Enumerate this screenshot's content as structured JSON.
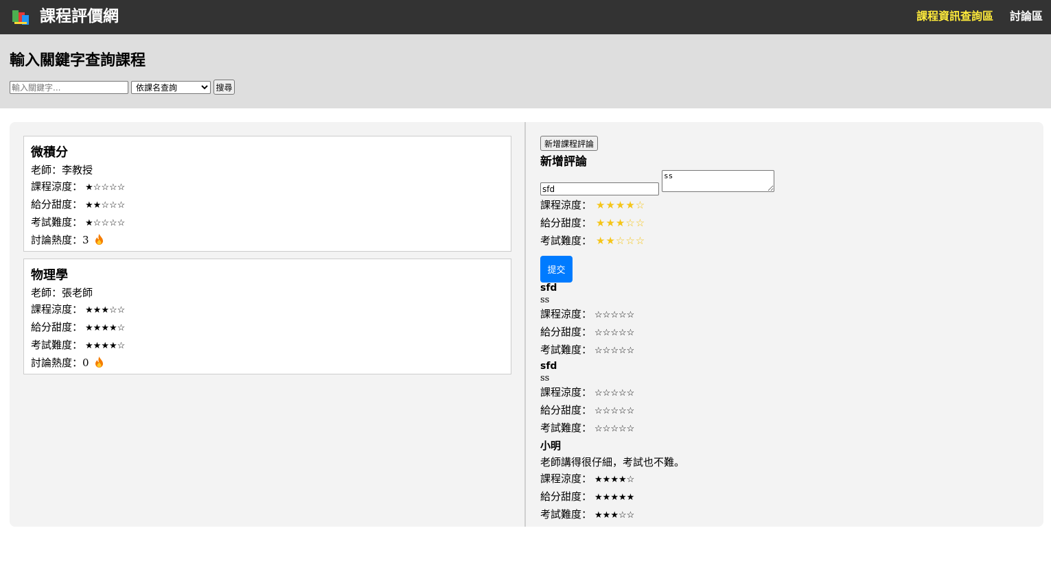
{
  "header": {
    "brand": "課程評價網",
    "nav": [
      {
        "label": "課程資訊查詢區",
        "active": true
      },
      {
        "label": "討論區",
        "active": false
      }
    ]
  },
  "search": {
    "title": "輸入關鍵字查詢課程",
    "placeholder": "輸入關鍵字...",
    "mode_selected": "依課名查詢",
    "button": "搜尋"
  },
  "labels": {
    "teacher": "老師：",
    "coolness": "課程涼度：",
    "sweetness": "給分甜度：",
    "difficulty": "考試難度：",
    "heat": "討論熱度："
  },
  "courses": [
    {
      "name": "微積分",
      "teacher": "李教授",
      "coolness": "★☆☆☆☆",
      "sweetness": "★★☆☆☆",
      "difficulty": "★☆☆☆☆",
      "heat": "3"
    },
    {
      "name": "物理學",
      "teacher": "張老師",
      "coolness": "★★★☆☆",
      "sweetness": "★★★★☆",
      "difficulty": "★★★★☆",
      "heat": "0"
    }
  ],
  "review_form": {
    "add_button": "新增課程評論",
    "title": "新增評論",
    "name_value": "sfd",
    "comment_value": "ss",
    "coolness": "★★★★☆",
    "sweetness": "★★★☆☆",
    "difficulty": "★★☆☆☆",
    "submit": "提交"
  },
  "reviews": [
    {
      "author": "sfd",
      "text": "ss",
      "coolness": "☆☆☆☆☆",
      "sweetness": "☆☆☆☆☆",
      "difficulty": "☆☆☆☆☆"
    },
    {
      "author": "sfd",
      "text": "ss",
      "coolness": "☆☆☆☆☆",
      "sweetness": "☆☆☆☆☆",
      "difficulty": "☆☆☆☆☆"
    },
    {
      "author": "小明",
      "text": "老師講得很仔細，考試也不難。",
      "coolness": "★★★★☆",
      "sweetness": "★★★★★",
      "difficulty": "★★★☆☆"
    }
  ],
  "colors": {
    "nav_bg": "#333333",
    "nav_active": "#ffeb3b",
    "search_bg": "#dedede",
    "panel_bg": "#f3f3f3",
    "submit_bg": "#007bff",
    "rating_gold": "#f5c518"
  },
  "icons": {
    "logo": "books-logo-icon",
    "heat": "fire-icon"
  }
}
